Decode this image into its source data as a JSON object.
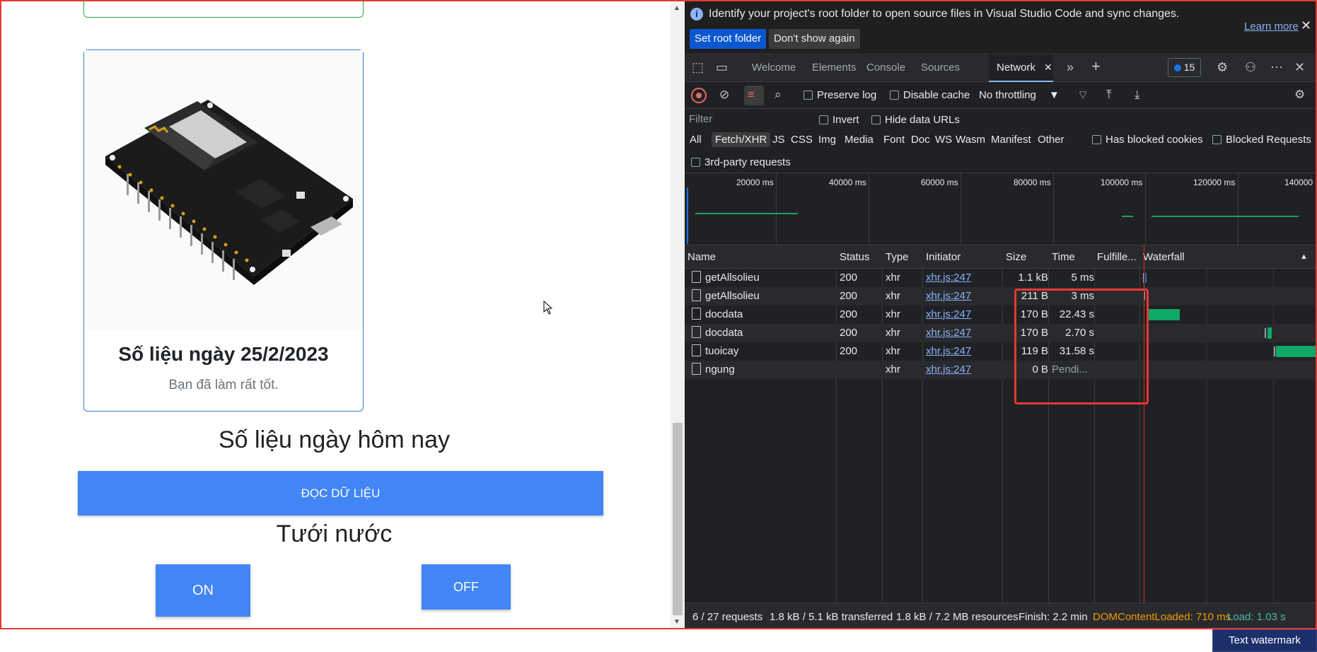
{
  "page": {
    "card_title": "Số liệu ngày 25/2/2023",
    "card_subtitle": "Bạn đã làm rất tốt.",
    "today_title": "Số liệu ngày hôm nay",
    "read_button": "ĐỌC DỮ LIỆU",
    "water_title": "Tưới nước",
    "on_button": "ON",
    "off_button": "OFF"
  },
  "devtools": {
    "banner": {
      "message": "Identify your project's root folder to open source files in Visual Studio Code and sync changes.",
      "learn_more": "Learn more",
      "set_root": "Set root folder",
      "dont_show": "Don't show again"
    },
    "tabs": [
      "Welcome",
      "Elements",
      "Console",
      "Sources",
      "Network"
    ],
    "issues_count": "15",
    "toolbar": {
      "preserve_log": "Preserve log",
      "disable_cache": "Disable cache",
      "throttling": "No throttling"
    },
    "filter": {
      "placeholder": "Filter",
      "invert": "Invert",
      "hide_data_urls": "Hide data URLs",
      "types": [
        "All",
        "Fetch/XHR",
        "JS",
        "CSS",
        "Img",
        "Media",
        "Font",
        "Doc",
        "WS",
        "Wasm",
        "Manifest",
        "Other"
      ],
      "has_blocked_cookies": "Has blocked cookies",
      "blocked_requests": "Blocked Requests",
      "third_party": "3rd-party requests"
    },
    "overview_ticks": [
      "20000 ms",
      "40000 ms",
      "60000 ms",
      "80000 ms",
      "100000 ms",
      "120000 ms",
      "140000"
    ],
    "columns": [
      "Name",
      "Status",
      "Type",
      "Initiator",
      "Size",
      "Time",
      "Fulfille...",
      "Waterfall"
    ],
    "rows": [
      {
        "name": "getAllsolieu",
        "status": "200",
        "type": "xhr",
        "initiator": "xhr.js:247",
        "size": "1.1 kB",
        "time": "5 ms"
      },
      {
        "name": "getAllsolieu",
        "status": "200",
        "type": "xhr",
        "initiator": "xhr.js:247",
        "size": "211 B",
        "time": "3 ms"
      },
      {
        "name": "docdata",
        "status": "200",
        "type": "xhr",
        "initiator": "xhr.js:247",
        "size": "170 B",
        "time": "22.43 s"
      },
      {
        "name": "docdata",
        "status": "200",
        "type": "xhr",
        "initiator": "xhr.js:247",
        "size": "170 B",
        "time": "2.70 s"
      },
      {
        "name": "tuoicay",
        "status": "200",
        "type": "xhr",
        "initiator": "xhr.js:247",
        "size": "119 B",
        "time": "31.58 s"
      },
      {
        "name": "ngung",
        "status": "",
        "type": "xhr",
        "initiator": "xhr.js:247",
        "size": "0 B",
        "time": "Pendi..."
      }
    ],
    "status": {
      "requests": "6 / 27 requests",
      "transferred": "1.8 kB / 5.1 kB transferred",
      "resources": "1.8 kB / 7.2 MB resources",
      "finish": "Finish: 2.2 min",
      "dom_loaded": "DOMContentLoaded: 710 ms",
      "load": "Load: 1.03 s"
    }
  },
  "watermark": "Text watermark"
}
